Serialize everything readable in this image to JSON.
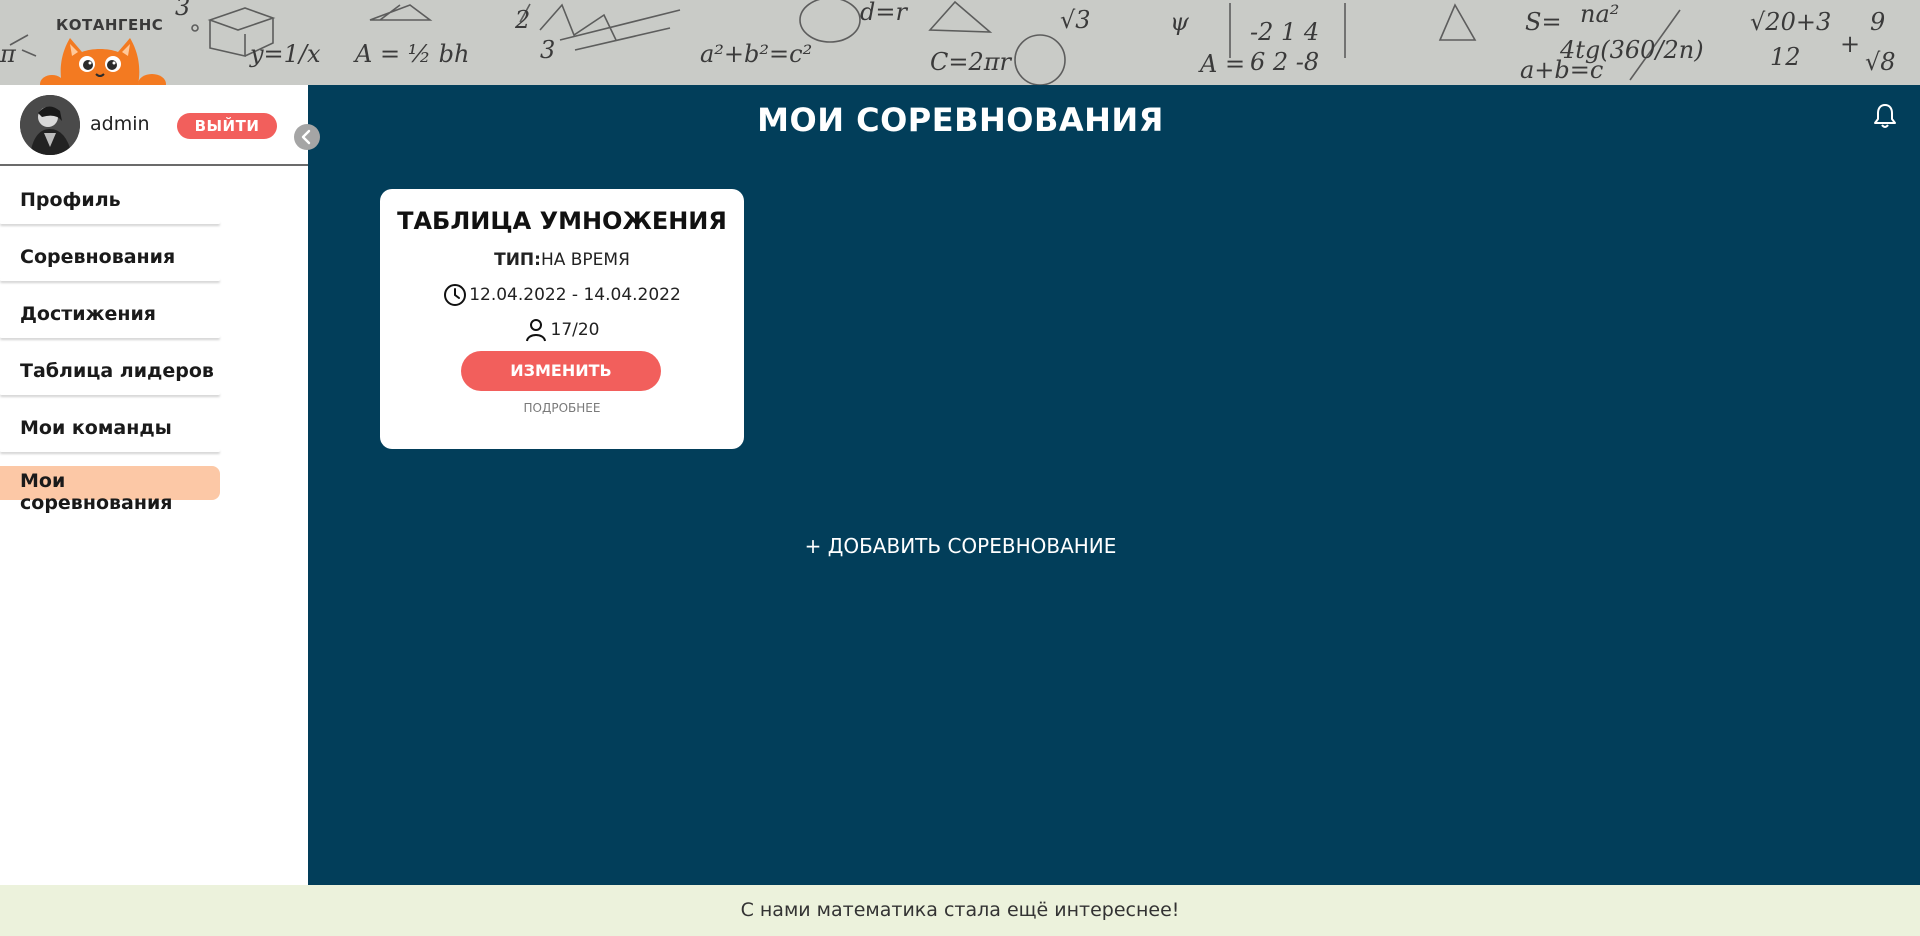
{
  "brand": {
    "name": "КОТАНГЕНС"
  },
  "user": {
    "name": "admin",
    "logout_label": "ВЫЙТИ"
  },
  "nav": {
    "items": [
      {
        "label": "Профиль",
        "active": false
      },
      {
        "label": "Соревнования",
        "active": false
      },
      {
        "label": "Достижения",
        "active": false
      },
      {
        "label": "Таблица лидеров",
        "active": false
      },
      {
        "label": "Мои команды",
        "active": false
      },
      {
        "label": "Мои соревнования",
        "active": true
      }
    ]
  },
  "main": {
    "title": "МОИ СОРЕВНОВАНИЯ",
    "competitions": [
      {
        "title": "ТАБЛИЦА УМНОЖЕНИЯ",
        "type_label": "ТИП:",
        "type_value": "НА ВРЕМЯ",
        "dates": "12.04.2022 - 14.04.2022",
        "participants": "17/20",
        "edit_label": "ИЗМЕНИТЬ",
        "details_label": "ПОДРОБНЕЕ"
      }
    ],
    "add_label": "+ ДОБАВИТЬ СОРЕВНОВАНИЕ"
  },
  "footer": {
    "text": "С нами математика стала ещё интереснее!"
  },
  "colors": {
    "main_bg": "#023e5a",
    "accent_red": "#f25f5c",
    "active_nav": "#fcc8a6",
    "footer_bg": "#ecf2dc",
    "banner_bg": "#c9cbc7",
    "cat_orange": "#f37a21"
  },
  "icons": {
    "bell": "bell-icon",
    "clock": "clock-icon",
    "user": "user-icon",
    "collapse": "chevron-left-icon"
  }
}
